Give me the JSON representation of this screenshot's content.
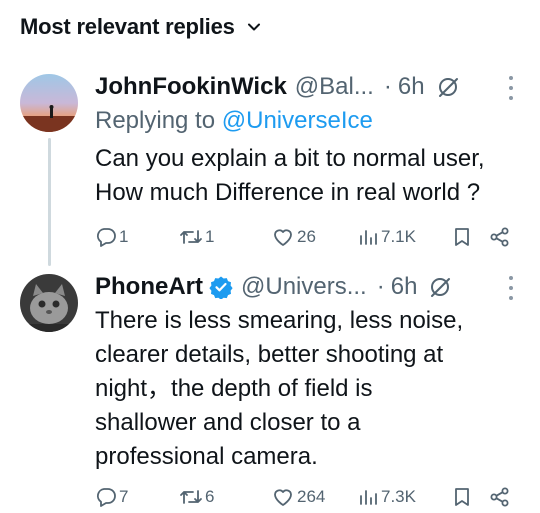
{
  "header": {
    "title": "Most relevant replies"
  },
  "replies": [
    {
      "name": "JohnFookinWick",
      "handle": "@Bal...",
      "dot": "·",
      "time": "6h",
      "replying_prefix": "Replying to ",
      "replying_to": "@UniverseIce",
      "text_lines": [
        "Can you explain a bit to normal user,",
        "How much Difference in real world ?"
      ],
      "stats": {
        "replies": "1",
        "reposts": "1",
        "likes": "26",
        "views": "7.1K"
      }
    },
    {
      "name": "PhoneArt",
      "verified": true,
      "handle": "@Univers...",
      "dot": "·",
      "time": "6h",
      "text_lines": [
        "There is less smearing, less noise,",
        "clearer details, better shooting at",
        "night，the depth of field is",
        "shallower and closer to a",
        "professional camera."
      ],
      "stats": {
        "replies": "7",
        "reposts": "6",
        "likes": "264",
        "views": "7.3K"
      }
    }
  ],
  "colors": {
    "accent": "#1d9bf0",
    "muted": "#536471",
    "text": "#0f1419",
    "line": "#cfd9de"
  }
}
